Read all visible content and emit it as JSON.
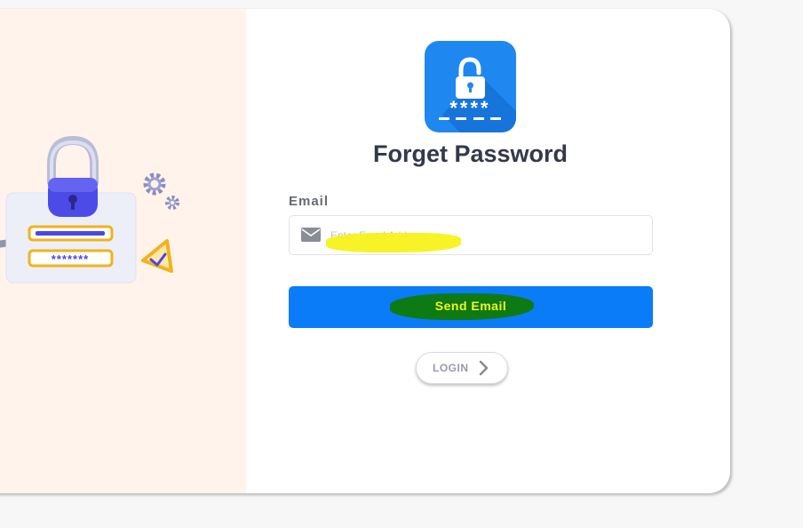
{
  "page": {
    "title": "Forget Password"
  },
  "form": {
    "email_label": "Email",
    "email_placeholder": "Enter Email Address",
    "email_value": "",
    "send_button_label": "Send Email",
    "login_button_label": "LOGIN"
  },
  "icons": {
    "app_icon": "padlock-password-icon",
    "input_icon": "envelope-icon",
    "login_icon": "chevron-right-icon"
  },
  "illustration": {
    "password_mask": "*******"
  },
  "colors": {
    "primary_button": "#0a7cf8",
    "app_icon_bg": "#1e88f0",
    "left_panel_bg": "#fff3ec",
    "title_text": "#33394a",
    "annotation_yellow": "#f7f21a",
    "annotation_green": "#0e7a14"
  }
}
